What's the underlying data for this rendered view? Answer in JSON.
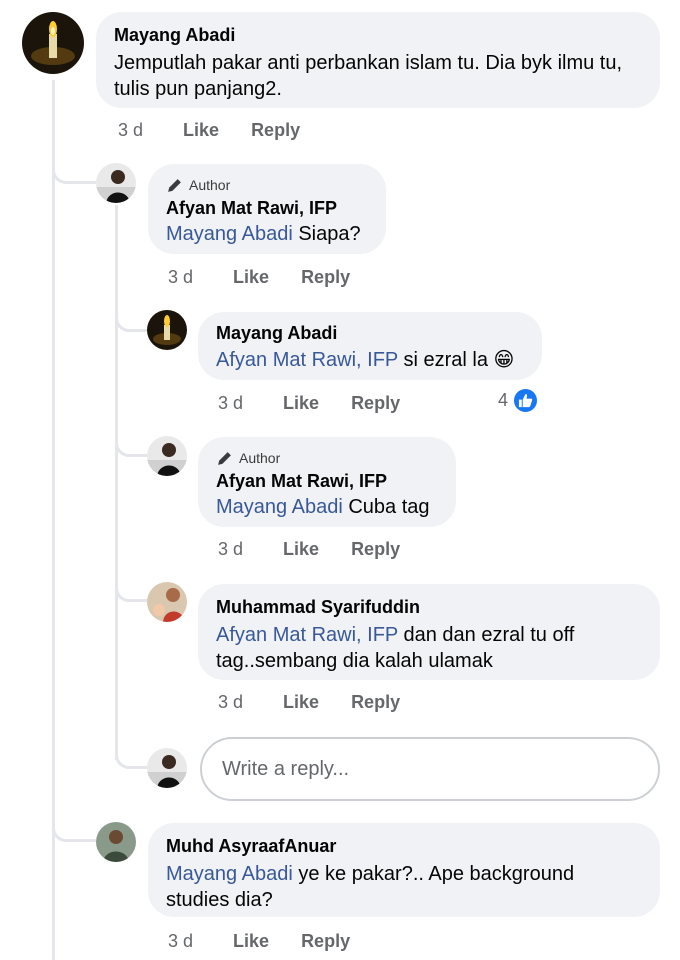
{
  "comments": [
    {
      "id": "c1",
      "author": "Mayang Abadi",
      "author_badge": "",
      "mention": "",
      "text": "Jemputlah pakar anti perbankan islam tu. Dia byk ilmu tu, tulis pun panjang2.",
      "time": "3 d",
      "like_label": "Like",
      "reply_label": "Reply"
    },
    {
      "id": "c2",
      "author": "Afyan Mat Rawi, IFP",
      "author_badge": "Author",
      "mention": "Mayang Abadi",
      "text": "Siapa?",
      "time": "3 d",
      "like_label": "Like",
      "reply_label": "Reply"
    },
    {
      "id": "c3",
      "author": "Mayang Abadi",
      "author_badge": "",
      "mention": "Afyan Mat Rawi, IFP",
      "text": "si ezral la 😁",
      "time": "3 d",
      "like_label": "Like",
      "reply_label": "Reply",
      "reactions": "4"
    },
    {
      "id": "c4",
      "author": "Afyan Mat Rawi, IFP",
      "author_badge": "Author",
      "mention": "Mayang Abadi",
      "text": "Cuba tag",
      "time": "3 d",
      "like_label": "Like",
      "reply_label": "Reply"
    },
    {
      "id": "c5",
      "author": "Muhammad Syarifuddin",
      "author_badge": "",
      "mention": "Afyan Mat Rawi, IFP",
      "text": "dan dan ezral tu off tag..sembang dia kalah ulamak",
      "time": "3 d",
      "like_label": "Like",
      "reply_label": "Reply"
    },
    {
      "id": "c6",
      "author": "Muhd AsyraafAnuar",
      "author_badge": "",
      "mention": "Mayang Abadi",
      "text": "ye ke pakar?.. Ape background studies dia?",
      "time": "3 d",
      "like_label": "Like",
      "reply_label": "Reply"
    }
  ],
  "reply_box": {
    "placeholder": "Write a reply..."
  },
  "colors": {
    "mention": "#385898",
    "bubble": "#f0f2f5",
    "meta": "#65676b",
    "like_blue": "#1877f2",
    "thread_line": "#e4e6eb"
  },
  "icons": {
    "author_badge": "pencil-icon",
    "reaction": "like-thumb-icon"
  }
}
